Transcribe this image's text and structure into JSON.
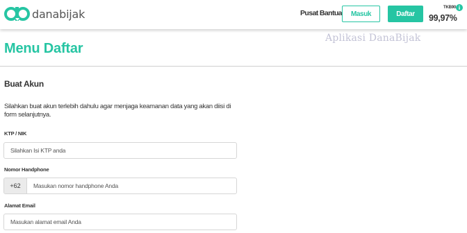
{
  "header": {
    "logo_text": "danabijak",
    "help_link": "Pusat Bantuan",
    "login_button": "Masuk",
    "register_button": "Daftar",
    "tkb_label": "TKB90",
    "tkb_value": "99,97%",
    "icons": [
      "danabijak-logo-icon",
      "info-icon"
    ],
    "accent_color": "#26c5a3"
  },
  "watermark": "Aplikasi DanaBijak",
  "page": {
    "title": "Menu Daftar"
  },
  "form": {
    "section_title": "Buat Akun",
    "intro_text": "Silahkan buat akun terlebih dahulu agar menjaga keamanan data yang akan diisi di form selanjutnya.",
    "ktp": {
      "label": "KTP / NIK",
      "placeholder": "Silahkan Isi KTP anda",
      "value": ""
    },
    "phone": {
      "label": "Nomor Handphone",
      "prefix": "+62",
      "placeholder": "Masukan nomor handphone Anda",
      "value": ""
    },
    "email": {
      "label": "Alamat Email",
      "placeholder": "Masukan alamat email Anda",
      "value": ""
    }
  }
}
